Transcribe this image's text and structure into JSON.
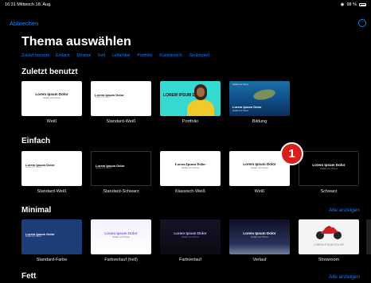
{
  "status": {
    "time_date": "16:31  Mittwoch 18. Aug.",
    "battery": "98 %"
  },
  "nav": {
    "cancel_label": "Abbrechen",
    "more_icon": "ellipsis-circle-icon"
  },
  "header": {
    "title": "Thema auswählen",
    "categories": [
      "Zuletzt benutzt",
      "Einfach",
      "Minimal",
      "Fett",
      "Leitartikel",
      "Portfolio",
      "Künstlerisch",
      "Strukturiert"
    ]
  },
  "badge": {
    "text": "1",
    "color": "#d8201a"
  },
  "accent": "#0a84ff",
  "sections": [
    {
      "title": "Zuletzt benutzt",
      "see_all": "",
      "items": [
        {
          "label": "Weiß",
          "preview_title": "Lorem Ipsum Dolor",
          "preview_sub": "Details zum Thema"
        },
        {
          "label": "Standard-Weiß",
          "preview_title": "Lorem Ipsum Dolor",
          "preview_sub": "Details zum Thema"
        },
        {
          "label": "Portfolio",
          "preview_title": "LOREM IPSUM DOLOR"
        },
        {
          "label": "Bildung",
          "preview_title": "Lorem Ipsum Dolor",
          "preview_sub": "Details zum Thema",
          "preview_top": "Details zum Thema"
        }
      ]
    },
    {
      "title": "Einfach",
      "see_all": "",
      "items": [
        {
          "label": "Standard-Weiß",
          "preview_title": "Lorem Ipsum Dolor",
          "preview_sub": "Details zum Thema"
        },
        {
          "label": "Standard-Schwarz",
          "preview_title": "Lorem Ipsum Dolor",
          "preview_sub": "Details zum Thema"
        },
        {
          "label": "Klassisch-Weiß",
          "preview_title": "Lorem Ipsum Dolor",
          "preview_sub": "Details zum Thema"
        },
        {
          "label": "Weiß",
          "preview_title": "Lorem Ipsum Dolor",
          "preview_sub": "Details zum Thema"
        },
        {
          "label": "Schwarz",
          "preview_title": "Lorem Ipsum Dolor",
          "preview_sub": "Details zum Thema"
        }
      ]
    },
    {
      "title": "Minimal",
      "see_all": "Alle anzeigen",
      "items": [
        {
          "label": "Standard-Farbe",
          "preview_title": "Lorem Ipsum Dolor",
          "preview_sub": "Details zum Thema"
        },
        {
          "label": "Farbverlauf (hell)",
          "preview_title": "Lorem Ipsum Dolor",
          "preview_sub": "Details zum Thema"
        },
        {
          "label": "Farbverlauf",
          "preview_title": "Lorem Ipsum Dolor",
          "preview_sub": "Details zum Thema"
        },
        {
          "label": "Verlauf",
          "preview_title": "Lorem Ipsum Dolor",
          "preview_sub": "Details zum Thema"
        },
        {
          "label": "Showroom",
          "preview_title": "LOREM IPSUM DOLOR"
        }
      ]
    },
    {
      "title": "Fett",
      "see_all": "Alle anzeigen",
      "items": []
    }
  ]
}
